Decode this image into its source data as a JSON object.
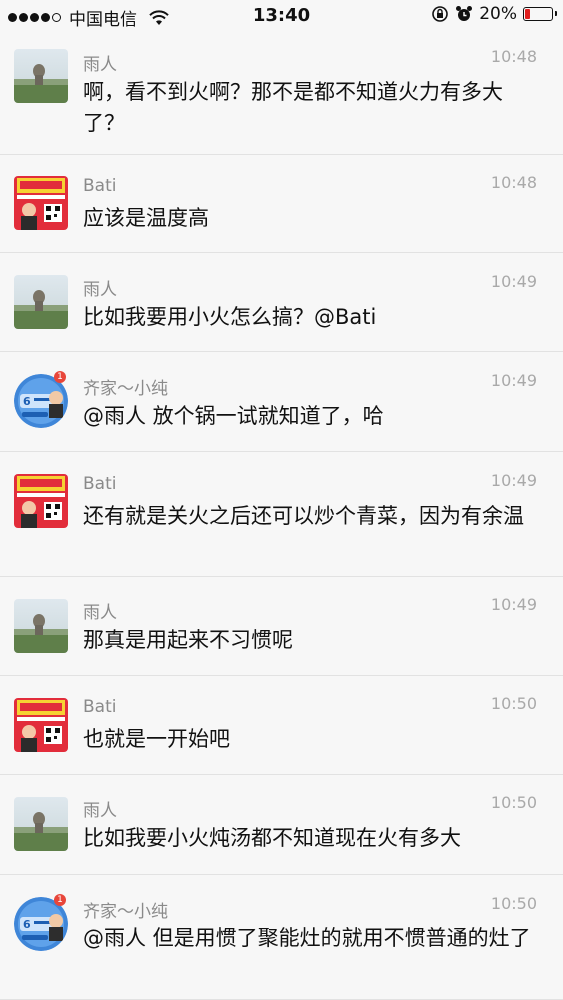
{
  "status_bar": {
    "carrier": "中国电信",
    "time": "13:40",
    "battery": "20%",
    "battery_level": 0.2
  },
  "messages": [
    {
      "sender": "雨人",
      "time": "10:48",
      "text": "啊，看不到火啊？那不是都不知道火力有多大了？",
      "avatar": "landscape-avatar"
    },
    {
      "sender": "Bati",
      "time": "10:48",
      "text": "应该是温度高",
      "avatar": "poster-avatar"
    },
    {
      "sender": "雨人",
      "time": "10:49",
      "text": "比如我要用小火怎么搞？@Bati",
      "avatar": "landscape-avatar"
    },
    {
      "sender": "齐家～小纯",
      "time": "10:49",
      "text": "@雨人 放个锅一试就知道了，哈",
      "avatar": "round-avatar",
      "badge": "1"
    },
    {
      "sender": "Bati",
      "time": "10:49",
      "text": "还有就是关火之后还可以炒个青菜，因为有余温",
      "avatar": "poster-avatar"
    },
    {
      "sender": "雨人",
      "time": "10:49",
      "text": "那真是用起来不习惯呢",
      "avatar": "landscape-avatar"
    },
    {
      "sender": "Bati",
      "time": "10:50",
      "text": "也就是一开始吧",
      "avatar": "poster-avatar"
    },
    {
      "sender": "雨人",
      "time": "10:50",
      "text": "比如我要小火炖汤都不知道现在火有多大",
      "avatar": "landscape-avatar"
    },
    {
      "sender": "齐家～小纯",
      "time": "10:50",
      "text": "@雨人 但是用惯了聚能灶的就用不惯普通的灶了",
      "avatar": "round-avatar",
      "badge": "1"
    }
  ]
}
